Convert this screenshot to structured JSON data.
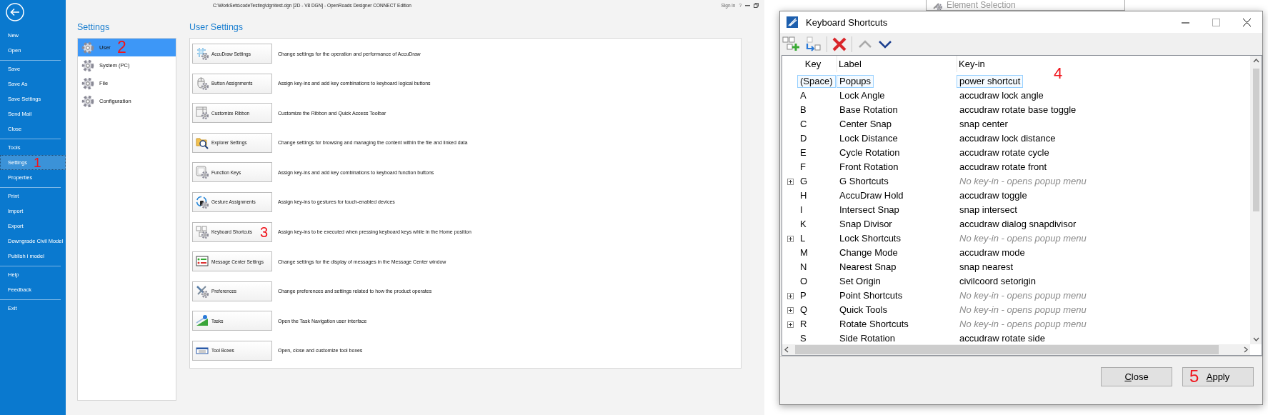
{
  "window": {
    "title": "C:\\WorkSets\\codeTesting\\dgn\\test.dgn [2D - V8 DGN] - OpenRoads Designer CONNECT Edition",
    "sign_in": "Sign in",
    "help": "?"
  },
  "sidebar": {
    "groups": [
      [
        {
          "label": "New",
          "selected": false
        },
        {
          "label": "Open",
          "selected": false
        }
      ],
      [
        {
          "label": "Save",
          "selected": false
        },
        {
          "label": "Save As",
          "selected": false
        },
        {
          "label": "Save Settings",
          "selected": false
        },
        {
          "label": "Send Mail",
          "selected": false
        },
        {
          "label": "Close",
          "selected": false
        }
      ],
      [
        {
          "label": "Tools",
          "selected": false
        },
        {
          "label": "Settings",
          "selected": true,
          "annotation": "1"
        },
        {
          "label": "Properties",
          "selected": false
        }
      ],
      [
        {
          "label": "Print",
          "selected": false
        },
        {
          "label": "Import",
          "selected": false
        },
        {
          "label": "Export",
          "selected": false
        },
        {
          "label": "Downgrade Civil Model",
          "selected": false
        },
        {
          "label": "Publish i model",
          "selected": false
        }
      ],
      [
        {
          "label": "Help",
          "selected": false
        },
        {
          "label": "Feedback",
          "selected": false
        }
      ],
      [
        {
          "label": "Exit",
          "selected": false
        }
      ]
    ]
  },
  "settings": {
    "title": "Settings",
    "items": [
      {
        "label": "User",
        "selected": true,
        "annotation": "2"
      },
      {
        "label": "System (PC)",
        "selected": false
      },
      {
        "label": "File",
        "selected": false
      },
      {
        "label": "Configuration",
        "selected": false
      }
    ]
  },
  "user_settings": {
    "title": "User Settings",
    "items": [
      {
        "label": "AccuDraw Settings",
        "description": "Change settings for the operation and performance of AccuDraw"
      },
      {
        "label": "Button Assignments",
        "description": "Assign key-ins and add key combinations to keyboard logical buttons"
      },
      {
        "label": "Customize Ribbon",
        "description": "Customize the Ribbon and Quick Access Toolbar"
      },
      {
        "label": "Explorer Settings",
        "description": "Change settings for browsing and managing the content within the file and linked data"
      },
      {
        "label": "Function Keys",
        "description": "Assign key-ins and add key combinations to keyboard function buttons"
      },
      {
        "label": "Gesture Assignments",
        "description": "Assign key-ins to gestures for touch-enabled devices"
      },
      {
        "label": "Keyboard Shortcuts",
        "description": "Assign key-ins to be executed when pressing keyboard keys while in the Home position",
        "annotation": "3"
      },
      {
        "label": "Message Center Settings",
        "description": "Change settings for the display of messages in the Message Center window"
      },
      {
        "label": "Preferences",
        "description": "Change preferences and settings related to how the product operates"
      },
      {
        "label": "Tasks",
        "description": "Open the Task Navigation user interface"
      },
      {
        "label": "Tool Boxes",
        "description": "Open, close and customize tool boxes"
      }
    ]
  },
  "background_window": {
    "title": "Element Selection"
  },
  "dialog": {
    "title": "Keyboard Shortcuts",
    "columns": [
      "Key",
      "Label",
      "Key-in"
    ],
    "rows": [
      {
        "key": "(Space)",
        "label": "Popups",
        "keyin": "power shortcut",
        "kind": "command",
        "selected": true,
        "annotation": "4"
      },
      {
        "key": "A",
        "label": "Lock Angle",
        "keyin": "accudraw lock angle",
        "kind": "command",
        "selected": false
      },
      {
        "key": "B",
        "label": "Base Rotation",
        "keyin": "accudraw rotate base toggle",
        "kind": "command",
        "selected": false
      },
      {
        "key": "C",
        "label": "Center Snap",
        "keyin": "snap center",
        "kind": "command",
        "selected": false
      },
      {
        "key": "D",
        "label": "Lock Distance",
        "keyin": "accudraw lock distance",
        "kind": "command",
        "selected": false
      },
      {
        "key": "E",
        "label": "Cycle Rotation",
        "keyin": "accudraw rotate cycle",
        "kind": "command",
        "selected": false
      },
      {
        "key": "F",
        "label": "Front Rotation",
        "keyin": "accudraw rotate front",
        "kind": "command",
        "selected": false
      },
      {
        "key": "G",
        "label": "G Shortcuts",
        "keyin": "No key-in - opens popup menu",
        "kind": "popup",
        "expanded": false,
        "selected": false
      },
      {
        "key": "H",
        "label": "AccuDraw Hold",
        "keyin": "accudraw toggle",
        "kind": "command",
        "selected": false
      },
      {
        "key": "I",
        "label": "Intersect Snap",
        "keyin": "snap intersect",
        "kind": "command",
        "selected": false
      },
      {
        "key": "K",
        "label": "Snap Divisor",
        "keyin": "accudraw dialog snapdivisor",
        "kind": "command",
        "selected": false
      },
      {
        "key": "L",
        "label": "Lock Shortcuts",
        "keyin": "No key-in - opens popup menu",
        "kind": "popup",
        "expanded": false,
        "selected": false
      },
      {
        "key": "M",
        "label": "Change Mode",
        "keyin": "accudraw mode",
        "kind": "command",
        "selected": false
      },
      {
        "key": "N",
        "label": "Nearest Snap",
        "keyin": "snap nearest",
        "kind": "command",
        "selected": false
      },
      {
        "key": "O",
        "label": "Set Origin",
        "keyin": "civilcoord setorigin",
        "kind": "command",
        "selected": false
      },
      {
        "key": "P",
        "label": "Point Shortcuts",
        "keyin": "No key-in - opens popup menu",
        "kind": "popup",
        "expanded": false,
        "selected": false
      },
      {
        "key": "Q",
        "label": "Quick Tools",
        "keyin": "No key-in - opens popup menu",
        "kind": "popup",
        "expanded": false,
        "selected": false
      },
      {
        "key": "R",
        "label": "Rotate Shortcuts",
        "keyin": "No key-in - opens popup menu",
        "kind": "popup",
        "expanded": false,
        "selected": false
      },
      {
        "key": "S",
        "label": "Side Rotation",
        "keyin": "accudraw rotate side",
        "kind": "command",
        "selected": false
      }
    ],
    "buttons": [
      {
        "label": "Close",
        "underline_first": true
      },
      {
        "label": "Apply",
        "underline_first": true,
        "annotation": "5"
      }
    ]
  }
}
